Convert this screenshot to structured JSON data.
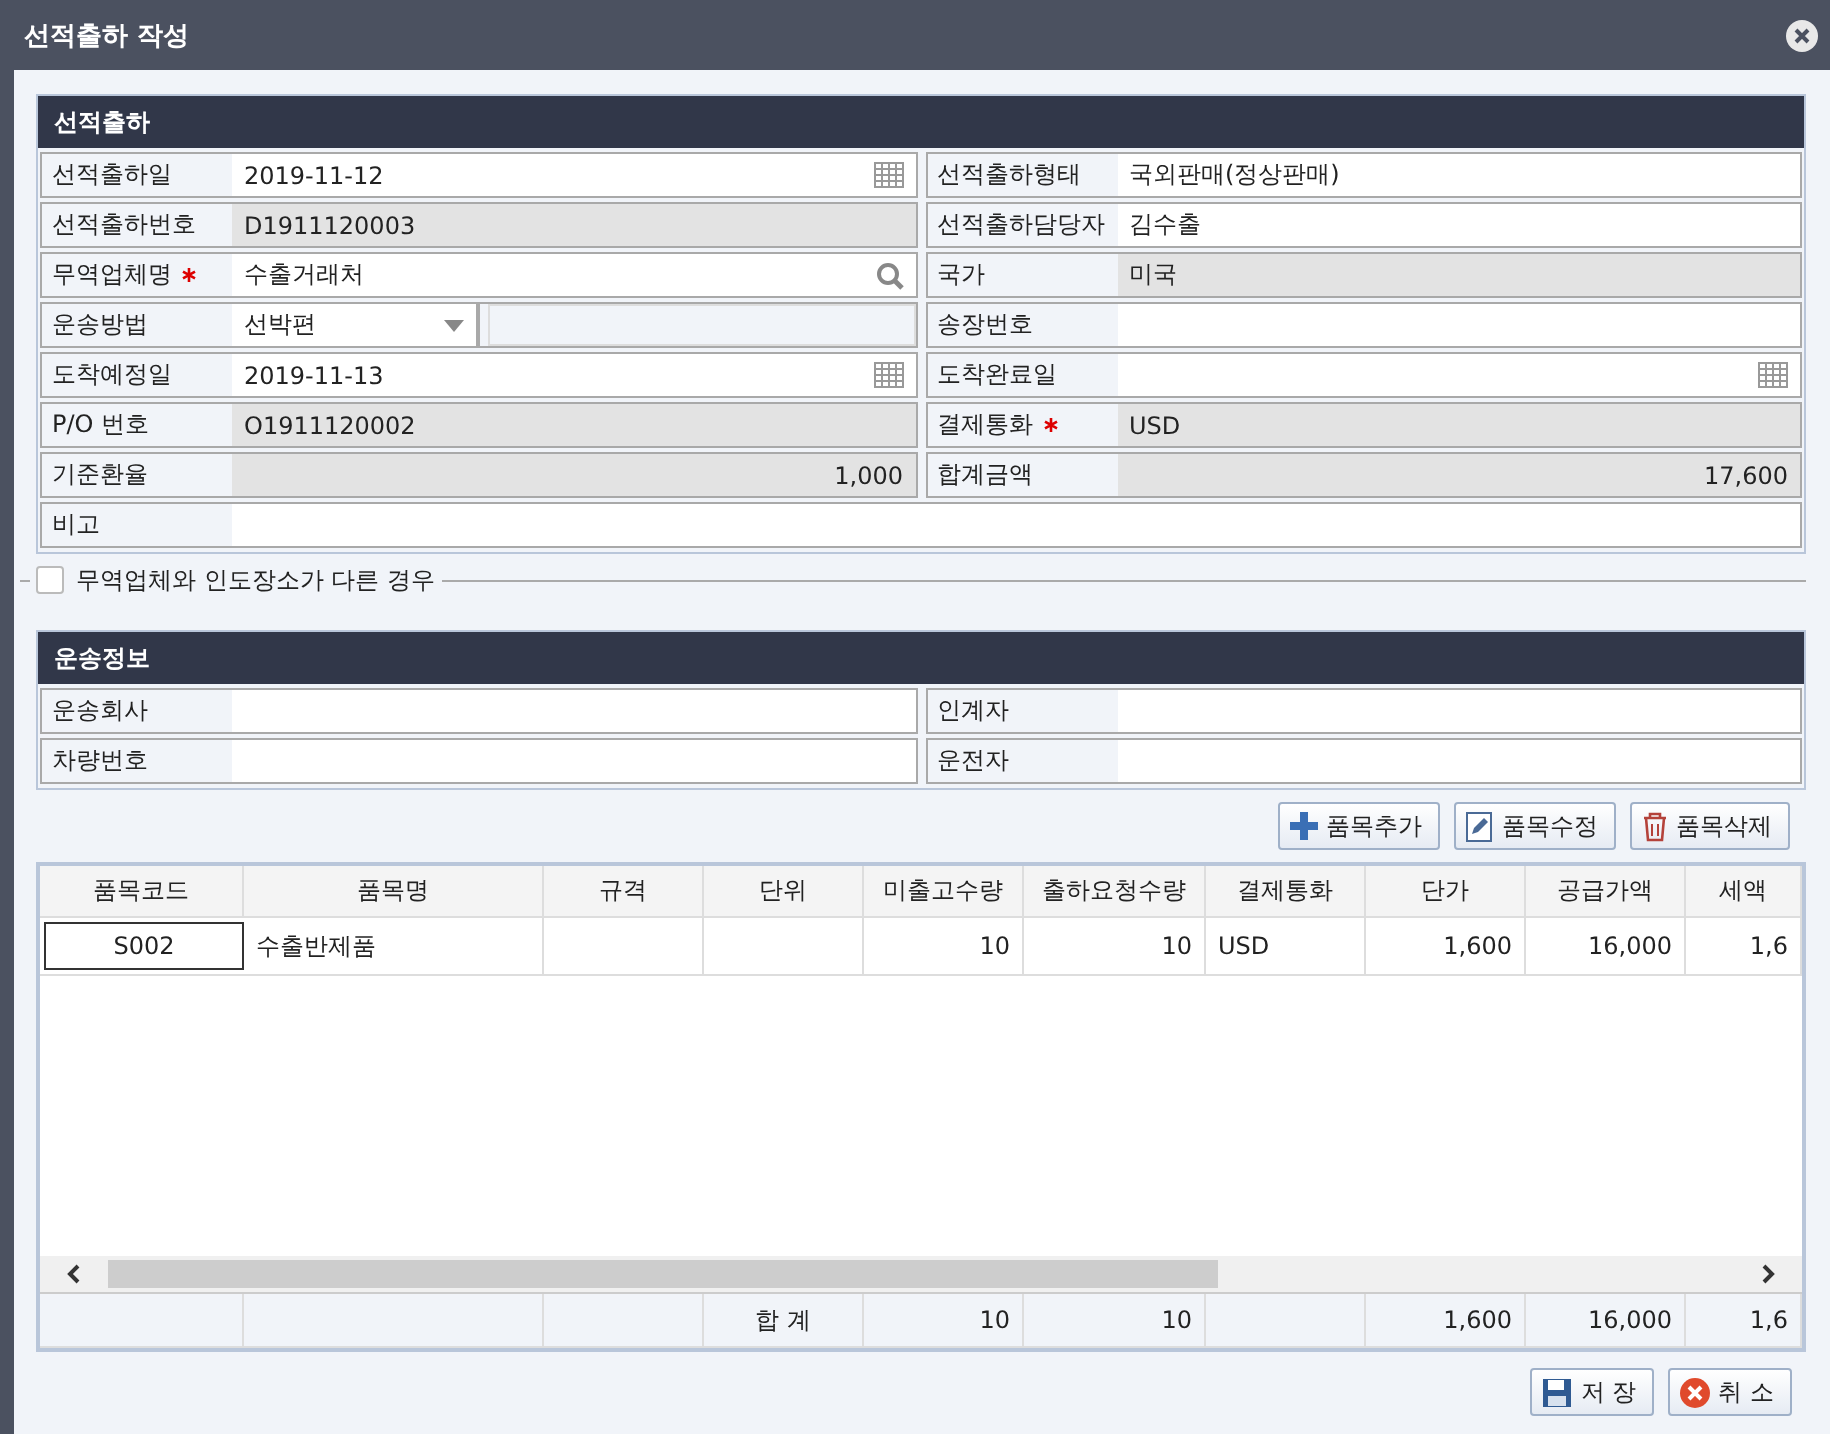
{
  "window": {
    "title": "선적출하 작성"
  },
  "shipment": {
    "title": "선적출하",
    "rows": [
      {
        "left": {
          "label": "선적출하일",
          "value": "2019-11-12",
          "kind": "date",
          "required": false
        },
        "right": {
          "label": "선적출하형태",
          "value": "국외판매(정상판매)",
          "kind": "text",
          "required": false
        }
      },
      {
        "left": {
          "label": "선적출하번호",
          "value": "D1911120003",
          "kind": "readonly",
          "required": false
        },
        "right": {
          "label": "선적출하담당자",
          "value": "김수출",
          "kind": "text",
          "required": false
        }
      },
      {
        "left": {
          "label": "무역업체명",
          "value": "수출거래처",
          "kind": "search",
          "required": true
        },
        "right": {
          "label": "국가",
          "value": "미국",
          "kind": "readonly",
          "required": false
        }
      },
      {
        "left": {
          "label": "운송방법",
          "value": "선박편",
          "kind": "select",
          "required": false
        },
        "right": {
          "label": "송장번호",
          "kind": "text",
          "required": false
        }
      },
      {
        "left": {
          "label": "도착예정일",
          "value": "2019-11-13",
          "kind": "date",
          "required": false
        },
        "right": {
          "label": "도착완료일",
          "kind": "date",
          "required": false
        }
      },
      {
        "left": {
          "label": "P/O 번호",
          "value": "O1911120002",
          "kind": "readonly",
          "required": false
        },
        "right": {
          "label": "결제통화",
          "value": "USD",
          "kind": "readonly",
          "required": true
        }
      },
      {
        "left": {
          "label": "기준환율",
          "value": "1,000",
          "kind": "amount",
          "required": false
        },
        "right": {
          "label": "합계금액",
          "value": "17,600",
          "kind": "amount",
          "required": false
        }
      }
    ],
    "remark": {
      "label": "비고"
    },
    "different_place": {
      "label": "무역업체와 인도장소가 다른 경우",
      "checked": false
    }
  },
  "transport": {
    "title": "운송정보",
    "rows": [
      {
        "left": {
          "label": "운송회사",
          "kind": "text",
          "required": false
        },
        "right": {
          "label": "인계자",
          "kind": "text",
          "required": false
        }
      },
      {
        "left": {
          "label": "차량번호",
          "kind": "text",
          "required": false
        },
        "right": {
          "label": "운전자",
          "kind": "text",
          "required": false
        }
      }
    ]
  },
  "item_buttons": [
    {
      "label": "품목추가",
      "kind": "add"
    },
    {
      "label": "품목수정",
      "kind": "edit"
    },
    {
      "label": "품목삭제",
      "kind": "delete"
    }
  ],
  "table": {
    "columns": [
      {
        "label": "품목코드",
        "kind": "code"
      },
      {
        "label": "품목명",
        "kind": "text"
      },
      {
        "label": "규격",
        "kind": "text"
      },
      {
        "label": "단위",
        "kind": "text"
      },
      {
        "label": "미출고수량",
        "kind": "number"
      },
      {
        "label": "출하요청수량",
        "kind": "number"
      },
      {
        "label": "결제통화",
        "kind": "text"
      },
      {
        "label": "단가",
        "kind": "number"
      },
      {
        "label": "공급가액",
        "kind": "number"
      },
      {
        "label": "세액",
        "kind": "number"
      }
    ],
    "rows": [
      {
        "selected": true,
        "cells": [
          "S002",
          "수출반제품",
          null,
          null,
          "10",
          "10",
          "USD",
          "1,600",
          "16,000",
          "1,6"
        ]
      }
    ],
    "footer": {
      "label": "합 계",
      "totals": [
        "10",
        "10",
        "1,600",
        "16,000",
        "1,6"
      ]
    }
  },
  "footer_buttons": [
    {
      "label": "저 장",
      "kind": "save"
    },
    {
      "label": "취 소",
      "kind": "cancel"
    }
  ]
}
